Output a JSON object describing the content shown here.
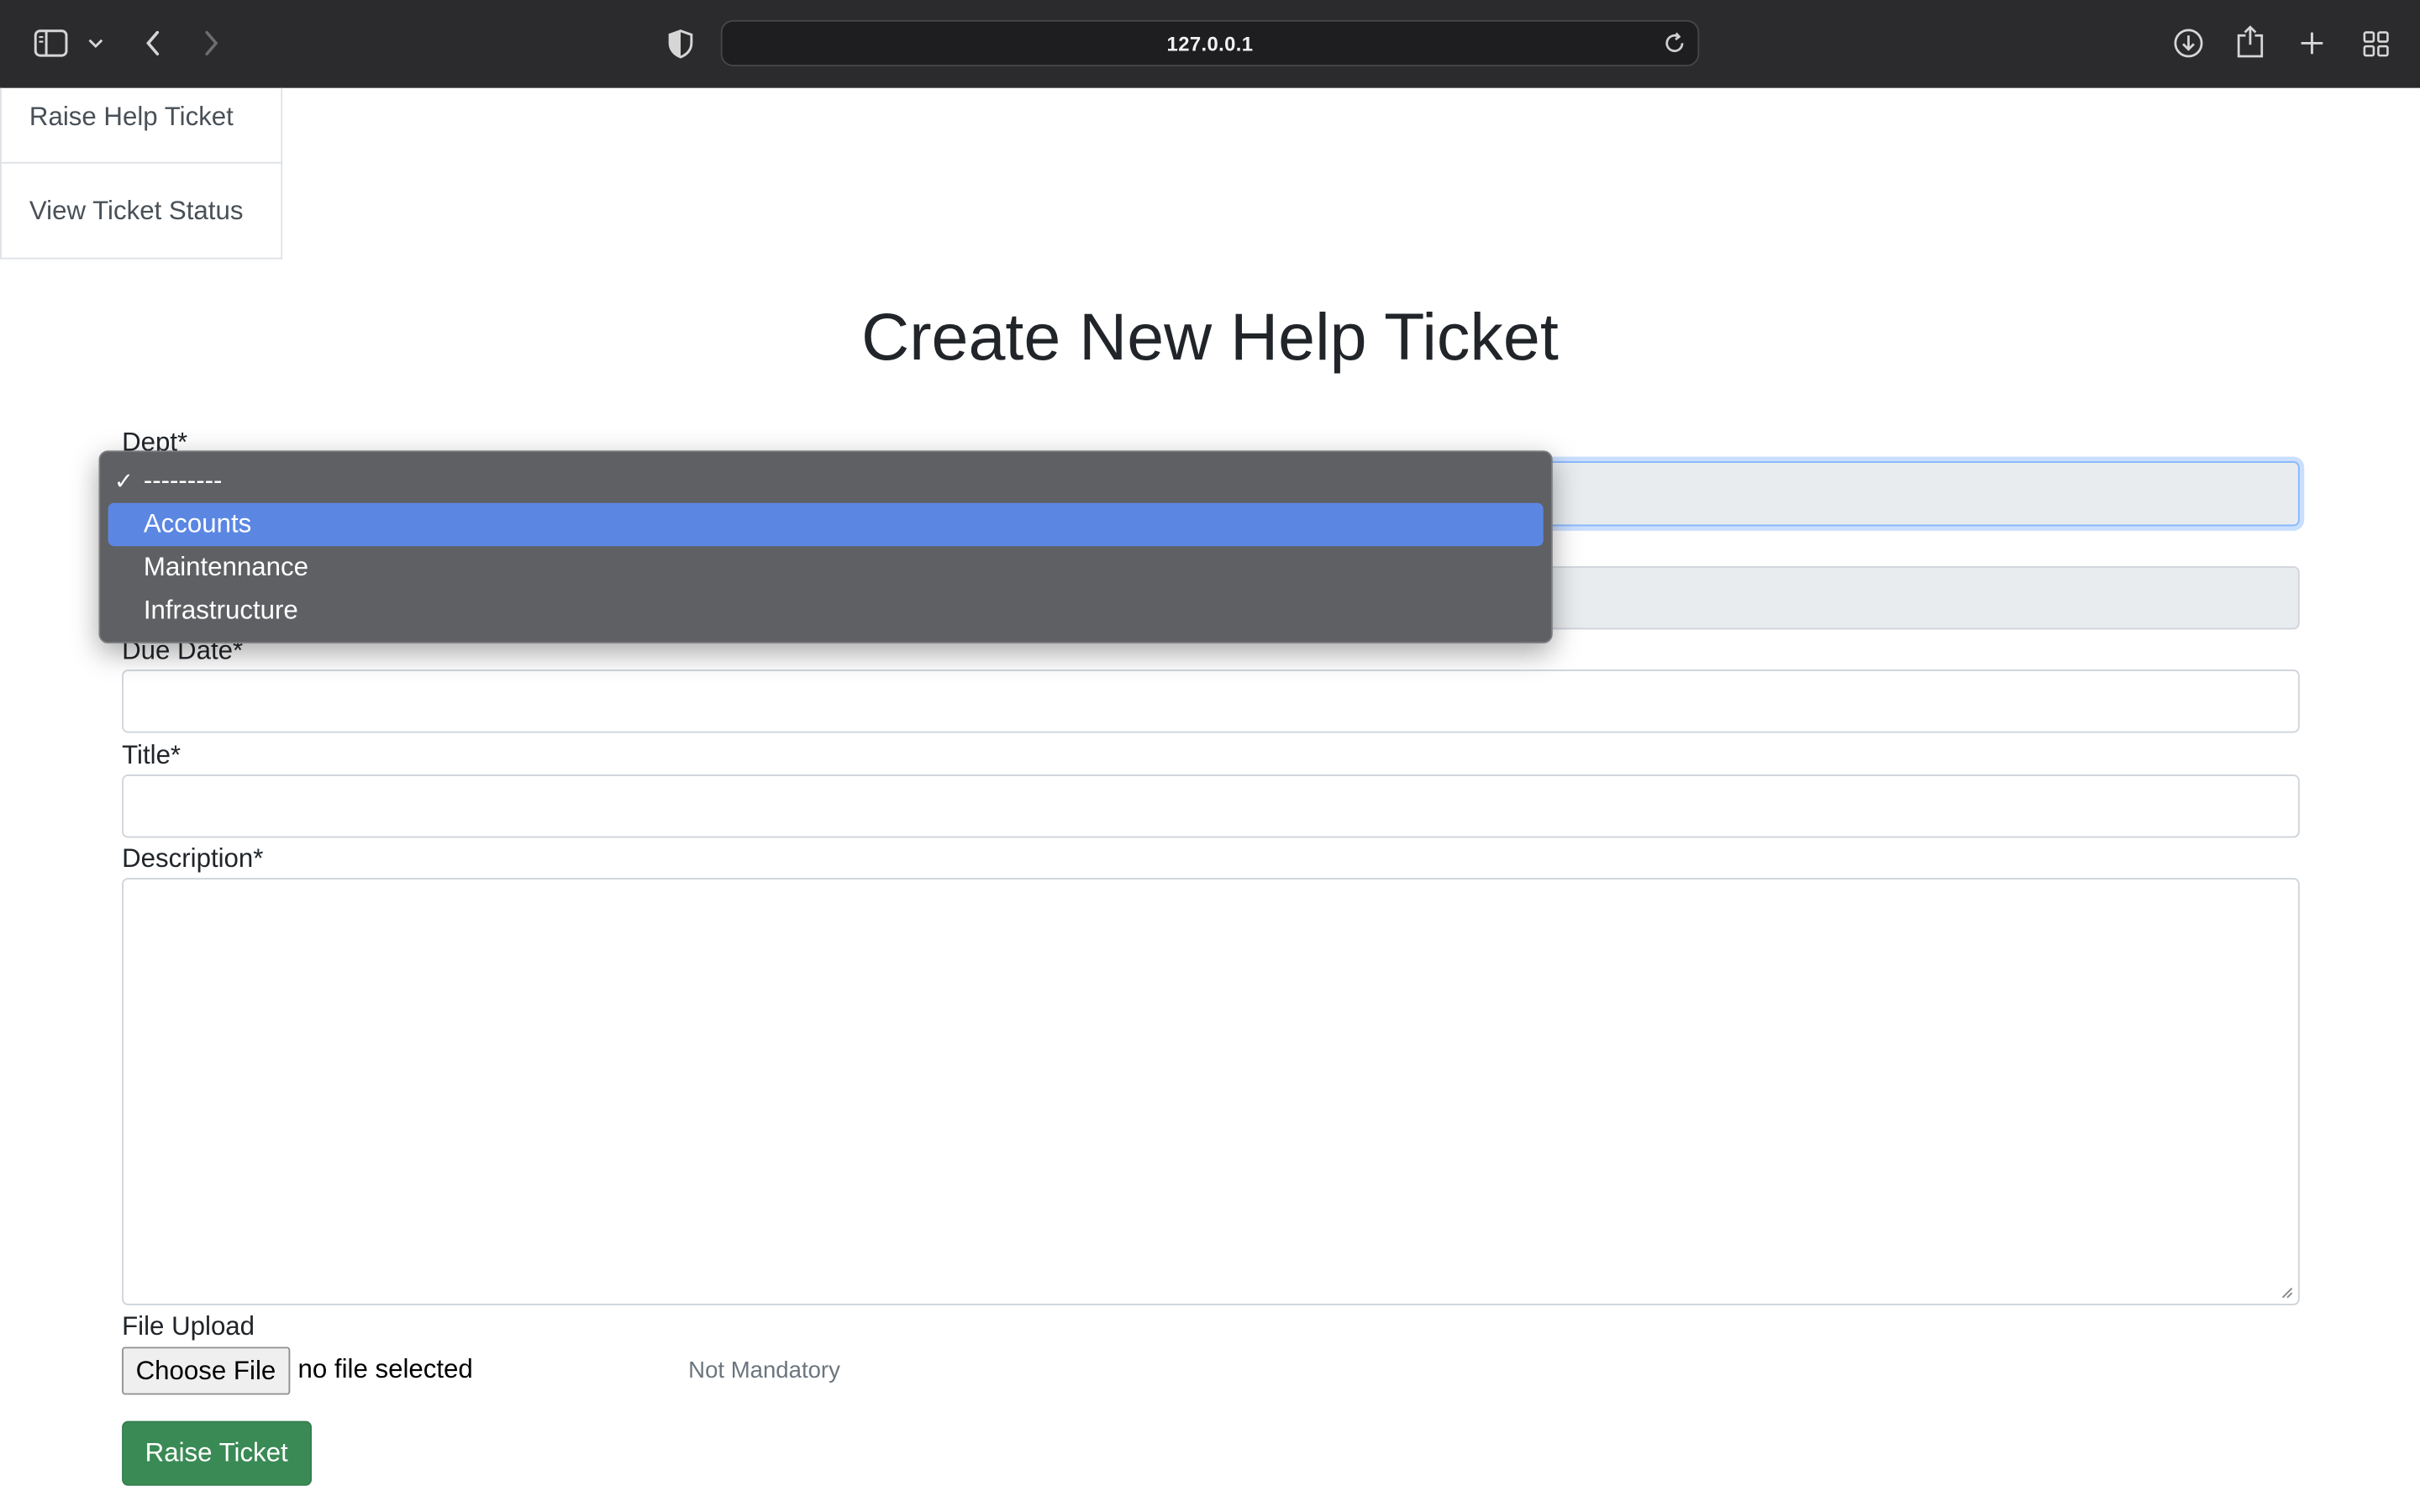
{
  "browser": {
    "url": "127.0.0.1",
    "icons": {
      "sidebar": "sidebar-icon",
      "sidebar_menu": "chevron-down-icon",
      "back": "back-arrow-icon",
      "forward": "forward-arrow-icon",
      "privacy": "shield-icon",
      "reload": "reload-icon",
      "downloads": "download-icon",
      "share": "share-icon",
      "new_tab": "plus-icon",
      "tab_overview": "grid-icon"
    }
  },
  "sidemenu": {
    "items": [
      {
        "label": "Raise Help Ticket"
      },
      {
        "label": "View Ticket Status"
      }
    ]
  },
  "page": {
    "title": "Create New Help Ticket"
  },
  "form": {
    "dept_label": "Dept*",
    "dept_options": [
      {
        "label": "---------",
        "checked": true,
        "highlighted": false
      },
      {
        "label": "Accounts",
        "checked": false,
        "highlighted": true
      },
      {
        "label": "Maintennance",
        "checked": false,
        "highlighted": false
      },
      {
        "label": "Infrastructure",
        "checked": false,
        "highlighted": false
      }
    ],
    "check_glyph": "✓",
    "due_date_label": "Due Date*",
    "title_label": "Title*",
    "description_label": "Description*",
    "file_upload_label": "File Upload",
    "choose_file_button": "Choose File",
    "no_file_text": "no file selected",
    "file_help_text": "Not Mandatory",
    "submit_button": "Raise Ticket"
  },
  "colors": {
    "chrome_bg": "#2b2b2d",
    "dropdown_bg": "#5f6063",
    "dropdown_highlight": "#5b87e3",
    "submit_bg": "#3a8a55",
    "focus_ring": "#86b7fe"
  }
}
